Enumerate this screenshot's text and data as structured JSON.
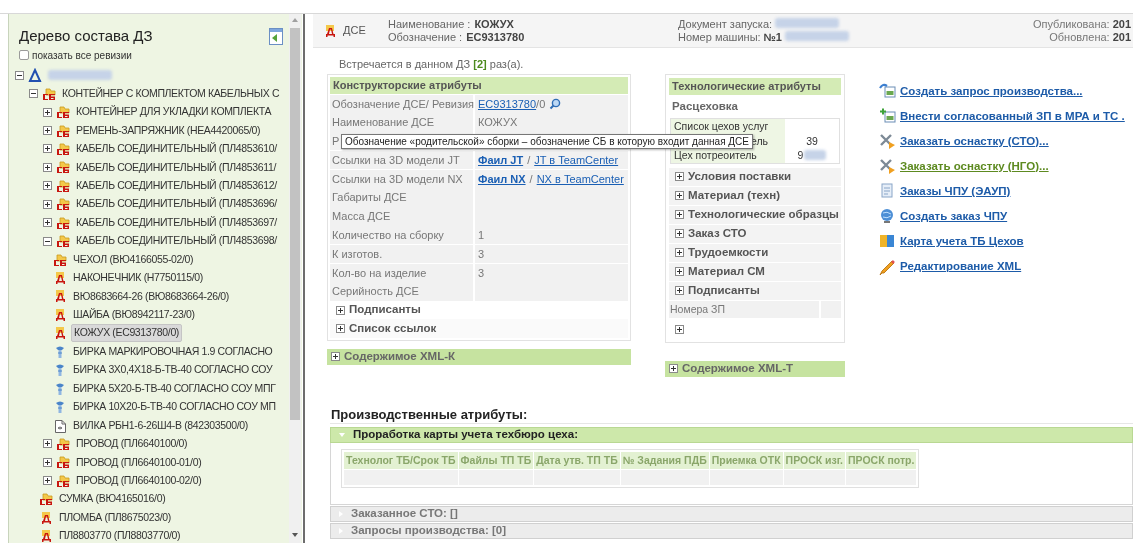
{
  "tree_panel": {
    "title": "Дерево состава ДЗ",
    "show_all_revisions": {
      "label": "показать все ревизии",
      "checked": false
    },
    "tree": [
      {
        "kind": "root",
        "expanded": true,
        "selected": false,
        "redacted": true,
        "children": [
          {
            "kind": "assembly",
            "label": "КОНТЕЙНЕР С КОМПЛЕКТОМ КАБЕЛЬНЫХ С",
            "expanded": true,
            "selected": false,
            "children": [
              {
                "kind": "assembly",
                "label": "КОНТЕЙНЕР ДЛЯ УКЛАДКИ КОМПЛЕКТА",
                "expanded": false,
                "selected": false
              },
              {
                "kind": "assembly",
                "label": "РЕМЕНЬ-ЗАПРЯЖНИК (НЕА4420065/0)",
                "expanded": false,
                "selected": false
              },
              {
                "kind": "assembly",
                "label": "КАБЕЛЬ СОЕДИНИТЕЛЬНЫЙ (ПЛ4853610/",
                "expanded": false,
                "selected": false
              },
              {
                "kind": "assembly",
                "label": "КАБЕЛЬ СОЕДИНИТЕЛЬНЫЙ (ПЛ4853611/",
                "expanded": false,
                "selected": false
              },
              {
                "kind": "assembly",
                "label": "КАБЕЛЬ СОЕДИНИТЕЛЬНЫЙ (ПЛ4853612/",
                "expanded": false,
                "selected": false
              },
              {
                "kind": "assembly",
                "label": "КАБЕЛЬ СОЕДИНИТЕЛЬНЫЙ (ПЛ4853696/",
                "expanded": false,
                "selected": false
              },
              {
                "kind": "assembly",
                "label": "КАБЕЛЬ СОЕДИНИТЕЛЬНЫЙ (ПЛ4853697/",
                "expanded": false,
                "selected": false
              },
              {
                "kind": "assembly",
                "label": "КАБЕЛЬ СОЕДИНИТЕЛЬНЫЙ (ПЛ4853698/",
                "expanded": true,
                "selected": false,
                "children": [
                  {
                    "kind": "assembly",
                    "label": "ЧЕХОЛ (ВЮ4166055-02/0)",
                    "selected": false
                  },
                  {
                    "kind": "part",
                    "label": "НАКОНЕЧНИК (Н7750115/0)",
                    "selected": false
                  },
                  {
                    "kind": "part",
                    "label": "ВЮ8683664-26 (ВЮ8683664-26/0)",
                    "selected": false
                  },
                  {
                    "kind": "part",
                    "label": "ШАЙБА (ВЮ8942117-23/0)",
                    "selected": false
                  },
                  {
                    "kind": "part",
                    "label": "КОЖУХ (ЕС9313780/0)",
                    "selected": true
                  },
                  {
                    "kind": "standard",
                    "label": "БИРКА МАРКИРОВОЧНАЯ 1.9 СОГЛАСНО",
                    "selected": false
                  },
                  {
                    "kind": "standard",
                    "label": "БИРКА 3Х0,4Х18-Б-ТВ-40 СОГЛАСНО СОУ",
                    "selected": false
                  },
                  {
                    "kind": "standard",
                    "label": "БИРКА 5Х20-Б-ТВ-40 СОГЛАСНО СОУ МПГ",
                    "selected": false
                  },
                  {
                    "kind": "standard",
                    "label": "БИРКА 10Х20-Б-ТВ-40 СОГЛАСНО СОУ МП",
                    "selected": false
                  },
                  {
                    "kind": "document",
                    "label": "ВИЛКА РБН1-6-26Ш4-В (842303500/0)",
                    "selected": false
                  }
                ]
              },
              {
                "kind": "assembly",
                "label": "ПРОВОД (ПЛ6640100/0)",
                "expanded": false,
                "selected": false
              },
              {
                "kind": "assembly",
                "label": "ПРОВОД (ПЛ6640100-01/0)",
                "expanded": false,
                "selected": false
              },
              {
                "kind": "assembly",
                "label": "ПРОВОД (ПЛ6640100-02/0)",
                "expanded": false,
                "selected": false
              },
              {
                "kind": "assembly",
                "label": "СУМКА (ВЮ4165016/0)",
                "selected": false
              },
              {
                "kind": "part",
                "label": "ПЛОМБА (ПЛ8675023/0)",
                "selected": false
              },
              {
                "kind": "part",
                "label": "ПЛ8803770 (ПЛ8803770/0)",
                "selected": false
              }
            ]
          }
        ]
      }
    ]
  },
  "header": {
    "type_label": "ДСЕ",
    "name_label": "Наименование :",
    "name": "КОЖУХ",
    "designation_label": "Обозначение :",
    "designation": "ЕС9313780",
    "launch_doc_label": "Документ запуска:",
    "launch_doc_redacted": true,
    "machine_label": "Номер машины:",
    "machine_number": "№1",
    "machine_redacted": true,
    "published_label": "Опубликована:",
    "published": "201",
    "updated_label": "Обновлена:",
    "updated": "201"
  },
  "occurrence": "Встречается в данном ДЗ **[2]** раз(а).",
  "design_attributes": {
    "title": "Конструкторские атрибуты",
    "rows": [
      {
        "kind": "designation",
        "label": "Обозначение ДСЕ/ Ревизия",
        "link": "ЕС9313780",
        "suffix": "/0"
      },
      {
        "kind": "text",
        "label": "Наименование ДСЕ",
        "value": "КОЖУХ"
      },
      {
        "kind": "text",
        "label": "Р"
      },
      {
        "kind": "links",
        "label": "Ссылки на 3D модели JT",
        "file": "Фаил JT",
        "separator": "/",
        "teamcenter": "JT в TeamCenter"
      },
      {
        "kind": "links",
        "label": "Ссылки на 3D модели NX",
        "file": "Фаил NX",
        "separator": "/",
        "teamcenter": "NX в TeamCenter"
      },
      {
        "kind": "text",
        "label": "Габариты ДСЕ"
      },
      {
        "kind": "text",
        "label": "Масса ДСЕ"
      },
      {
        "kind": "text",
        "label": "Количество на сборку",
        "value": "1"
      },
      {
        "kind": "text",
        "label": "К изготов.",
        "value": "3"
      },
      {
        "kind": "text",
        "label": "Кол-во на изделие",
        "value": "3"
      },
      {
        "kind": "text",
        "label": "Серийность ДСЕ"
      }
    ],
    "expanders": [
      {
        "label": "Подписанты",
        "expanded": false
      },
      {
        "label": "Список ссылок",
        "expanded": false
      }
    ]
  },
  "xml_k": {
    "label": "Содержимое XML-К",
    "expanded": false
  },
  "tech_attributes": {
    "title": "Технологические атрибуты",
    "subtitle": "Расцеховка",
    "workshops": [
      {
        "label": "Список цехов услуг",
        "redacted": false
      },
      {
        "label": "ель",
        "value": "39",
        "redacted": false
      },
      {
        "label": "Цех потреоитель",
        "value": "9",
        "redacted": true
      }
    ],
    "expanders": [
      {
        "label": "Условия поставки",
        "expanded": false
      },
      {
        "label": "Материал (техн)",
        "expanded": false
      },
      {
        "label": "Технологические образцы",
        "expanded": false
      },
      {
        "label": "Заказ СТО",
        "expanded": false
      },
      {
        "label": "Трудоемкости",
        "expanded": false
      },
      {
        "label": "Материал СМ",
        "expanded": false
      },
      {
        "label": "Подписанты",
        "expanded": false
      }
    ],
    "zp_label": "Номера ЗП",
    "zp_expander": {
      "expanded": false
    }
  },
  "xml_t": {
    "label": "Содержимое XML-Т",
    "expanded": false
  },
  "tooltip": {
    "text": "Обозначение «родительской» сборки – обозначение СБ в которую входит данная ДСЕ"
  },
  "actions": [
    {
      "kind": "request",
      "label": "Создать запрос производства...",
      "visited": false
    },
    {
      "kind": "add-request",
      "label": "Внести согласованный ЗП в МРА и ТС .",
      "visited": false
    },
    {
      "kind": "tools",
      "label": "Заказать оснастку (СТО)...",
      "visited": false
    },
    {
      "kind": "tools",
      "label": "Заказать оснастку (НГО)...",
      "visited": true
    },
    {
      "kind": "cnc-orders",
      "label": "Заказы ЧПУ (ЭАУП)",
      "visited": false
    },
    {
      "kind": "cnc-create",
      "label": "Создать заказ ЧПУ",
      "visited": false
    },
    {
      "kind": "card",
      "label": "Карта учета ТБ Цехов",
      "visited": false
    },
    {
      "kind": "edit",
      "label": "Редактирование XML",
      "visited": false
    }
  ],
  "production": {
    "title": "Производственные атрибуты:",
    "sections": [
      {
        "title": "Проработка карты учета техбюро цеха:",
        "expanded": true,
        "columns": [
          "Технолог ТБ/Срок ТБ",
          "Файлы ТП ТБ",
          "Дата утв. ТП ТБ",
          "№ Задания ПДБ",
          "Приемка ОТК",
          "ПРОСК изг.",
          "ПРОСК потр."
        ]
      },
      {
        "title": "Заказанное СТО: []",
        "expanded": false
      },
      {
        "title": "Запросы производства: [0]",
        "expanded": false
      }
    ]
  }
}
